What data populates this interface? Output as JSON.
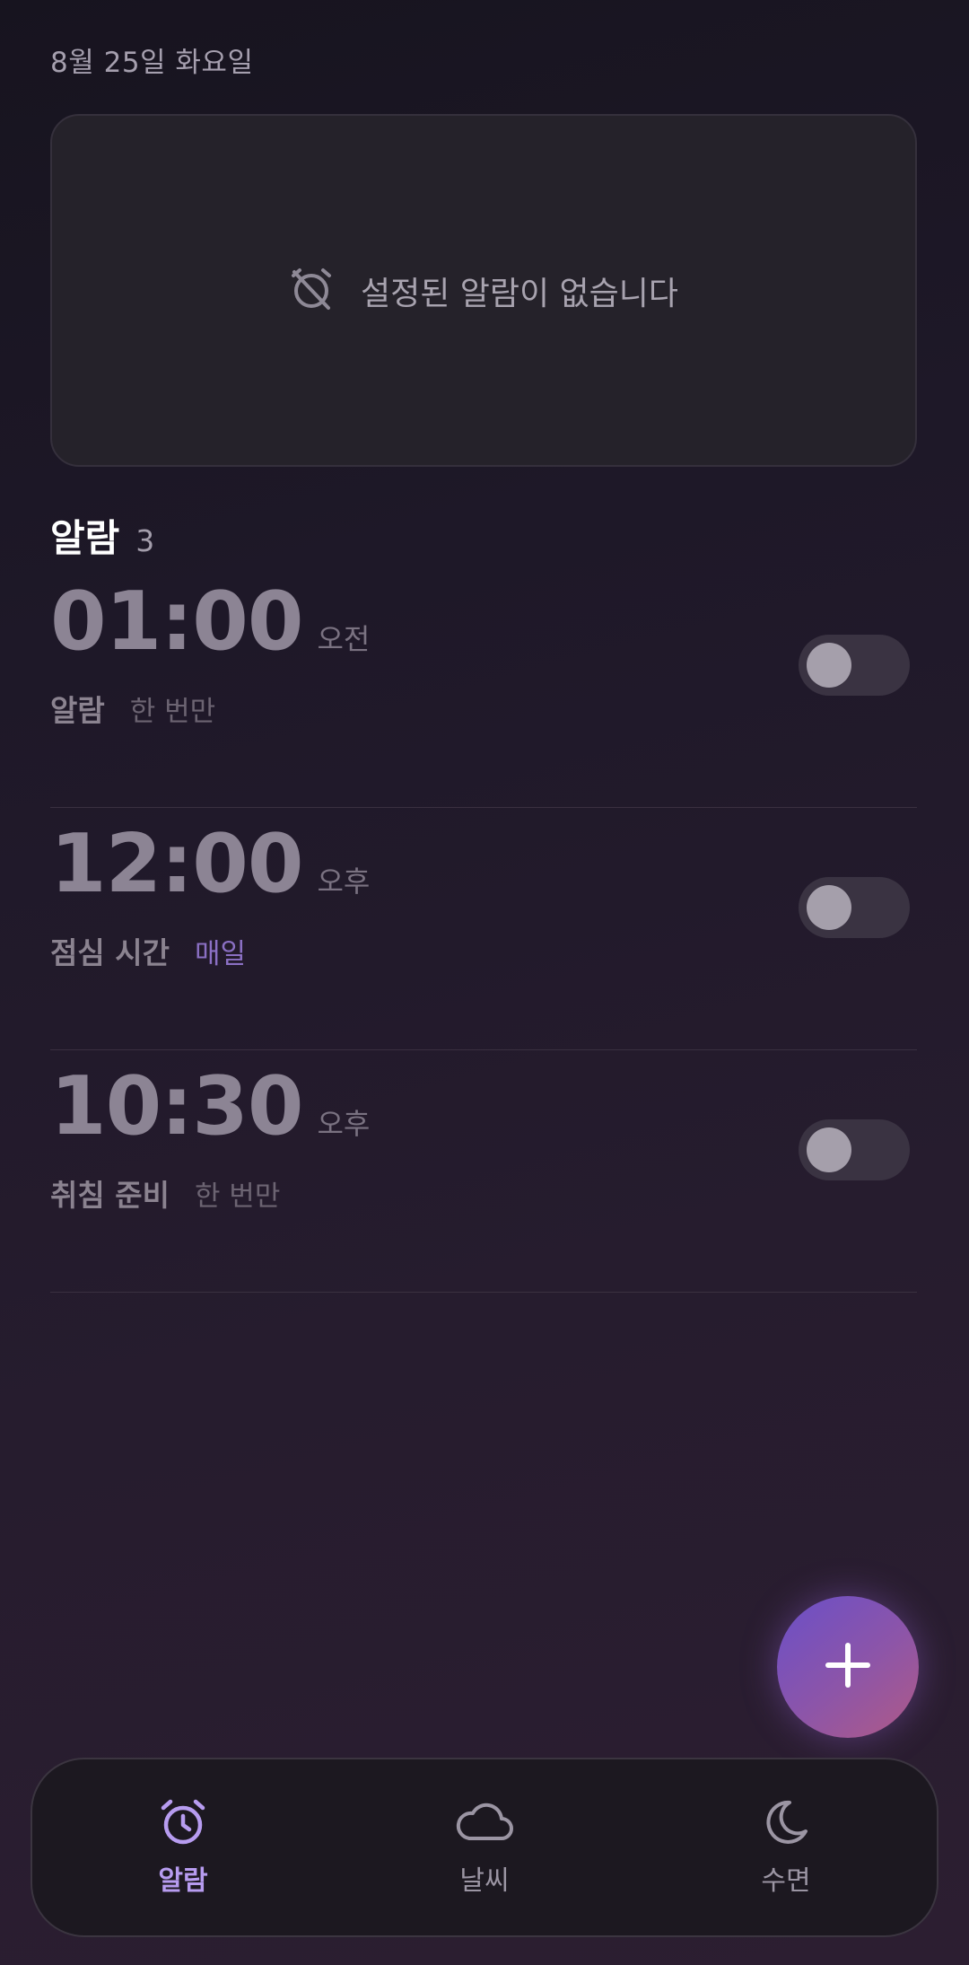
{
  "date": "8월 25일 화요일",
  "empty_state": {
    "icon": "alarm-off-icon",
    "text": "설정된 알람이 없습니다"
  },
  "alarms_section": {
    "title": "알람",
    "count": "3"
  },
  "alarms": [
    {
      "time": "01:00",
      "ampm": "오전",
      "name": "알람",
      "repeat": "한 번만",
      "enabled": false
    },
    {
      "time": "12:00",
      "ampm": "오후",
      "name": "점심 시간",
      "repeat": "매일",
      "enabled": false
    },
    {
      "time": "10:30",
      "ampm": "오후",
      "name": "취침 준비",
      "repeat": "한 번만",
      "enabled": false
    }
  ],
  "fab": {
    "icon": "plus-icon"
  },
  "nav": [
    {
      "label": "알람",
      "icon": "alarm-clock-icon",
      "active": true
    },
    {
      "label": "날씨",
      "icon": "cloud-icon",
      "active": false
    },
    {
      "label": "수면",
      "icon": "moon-icon",
      "active": false
    }
  ],
  "colors": {
    "accent": "#b79cf0",
    "repeat_accent": "#8b70c4",
    "fab_start": "#6a4fc8",
    "fab_end": "#b05a86",
    "toggle_track": "#3a3342",
    "toggle_knob": "#a59fab"
  }
}
